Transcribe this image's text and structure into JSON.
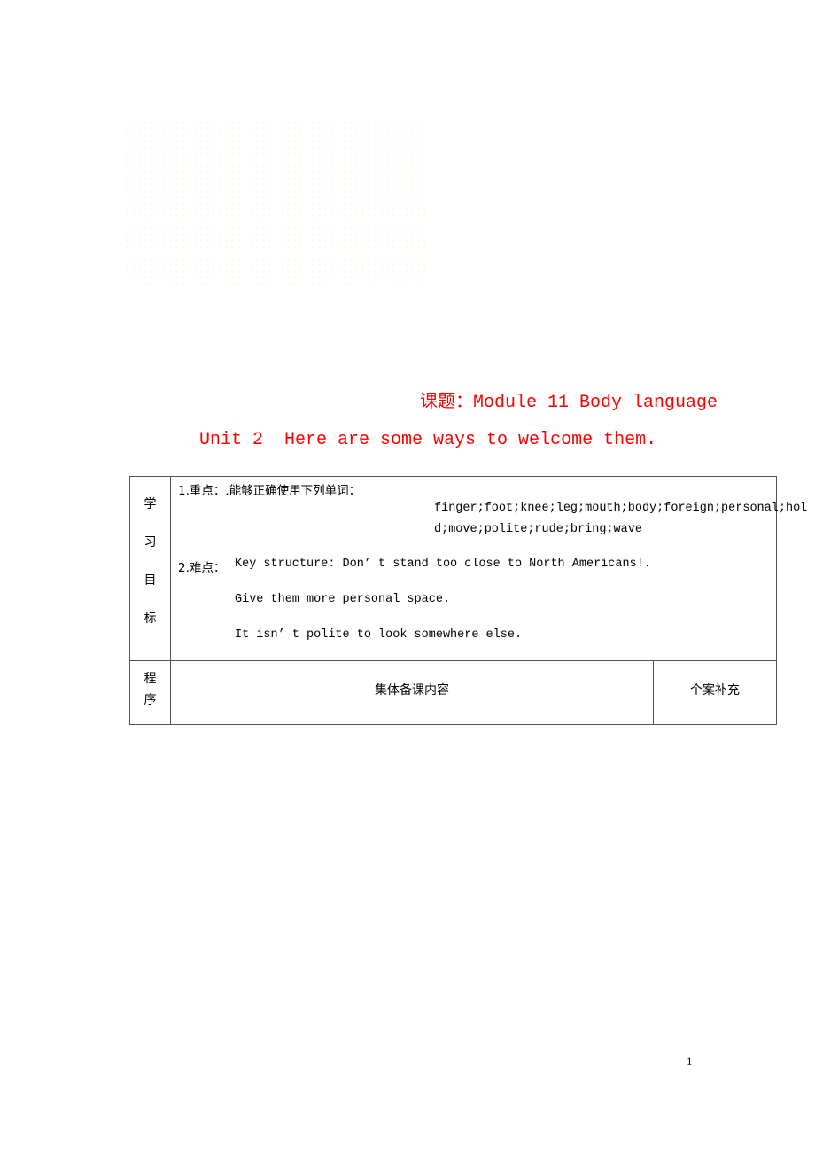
{
  "header": {
    "topic_line": "课题：Module 11 Body language",
    "unit_line": "Unit 2  Here are some ways to welcome them."
  },
  "table": {
    "goal_label_chars": [
      "学",
      "习",
      "目",
      "标"
    ],
    "goals": {
      "key_points_label": "1.重点：.能够正确使用下列单词：",
      "vocab_line1": "finger;foot;knee;leg;mouth;body;foreign;personal;hol",
      "vocab_line2": "d;move;polite;rude;bring;wave",
      "difficulty_label": "2.难点：",
      "difficulty_line1": "Key structure: Don’ t stand too close to North Americans!.",
      "difficulty_line2": "Give them more personal space.",
      "difficulty_line3": "It isn’ t polite to look somewhere else."
    },
    "procedure_label_chars": [
      "程",
      "序"
    ],
    "collective_header": "集体备课内容",
    "individual_header": "个案补充"
  },
  "footer": {
    "page_number": "1"
  }
}
